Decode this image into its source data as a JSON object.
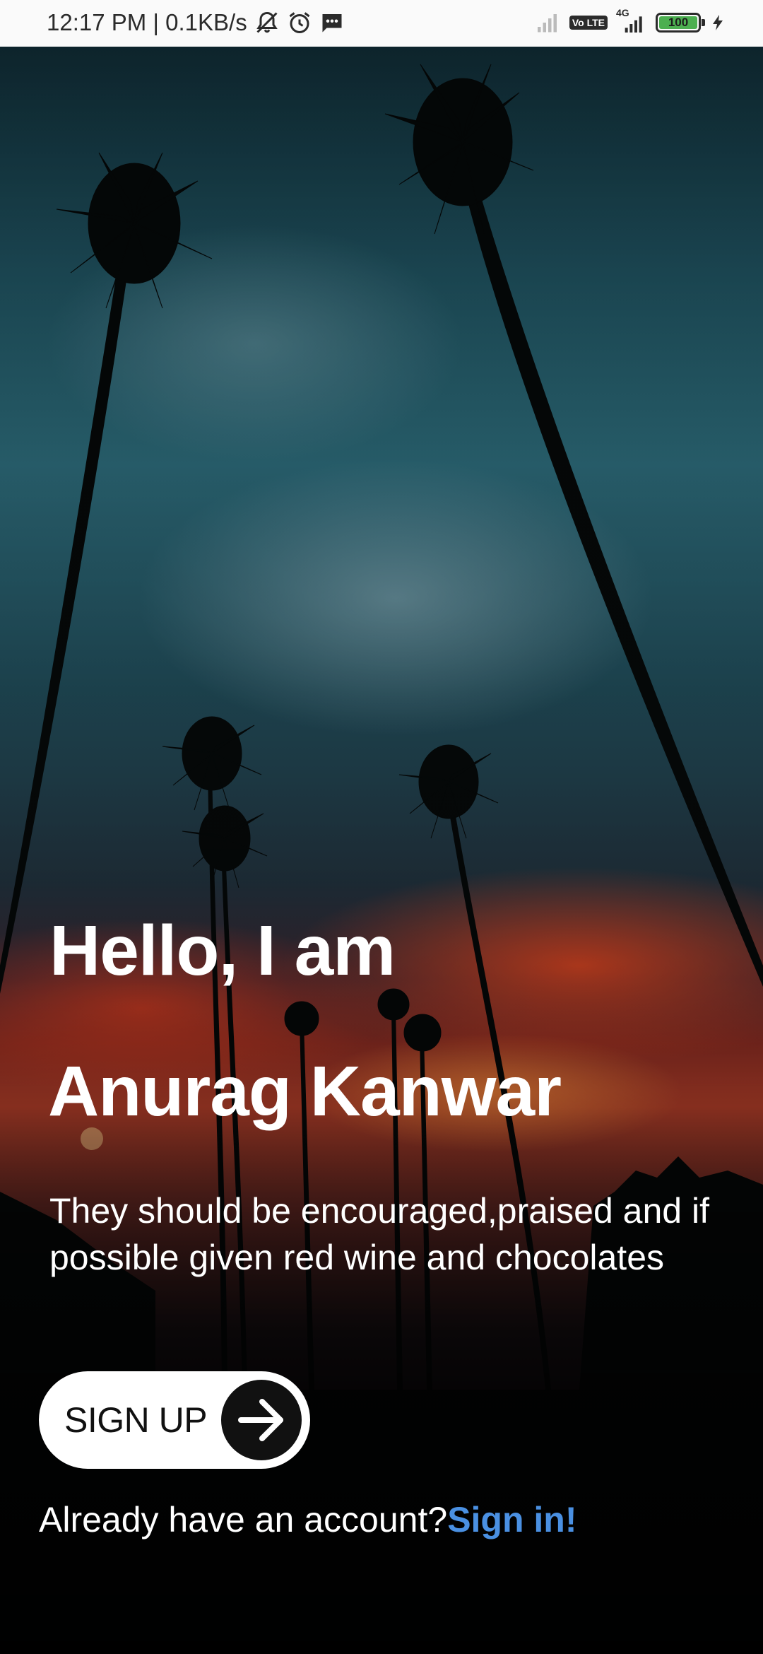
{
  "status_bar": {
    "time_speed": "12:17 PM | 0.1KB/s",
    "network_type": "4G",
    "volte_label": "Vo LTE",
    "battery_level": "100",
    "battery_color": "#4caf50"
  },
  "hero": {
    "greeting": "Hello, I am",
    "name": "Anurag Kanwar",
    "tagline": "They should be encouraged,praised and if possible given red wine and chocolates"
  },
  "signup_button": {
    "label": "SIGN UP",
    "icon": "arrow-right-icon"
  },
  "signin_prompt": {
    "text": "Already have an account?",
    "link_label": "Sign in!",
    "link_color": "#4a90e2"
  }
}
